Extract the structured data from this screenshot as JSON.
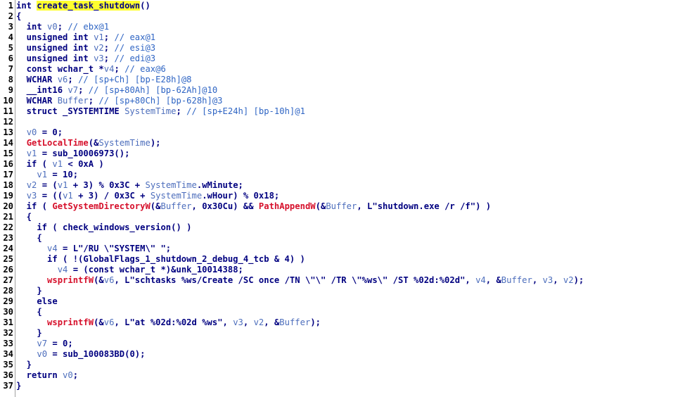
{
  "pseudocode": {
    "function_name": "create_task_shutdown",
    "lines": [
      {
        "n": "1",
        "t": [
          [
            "n",
            "int "
          ],
          [
            "h",
            "create_task_shutdown"
          ],
          [
            "n",
            "()"
          ]
        ]
      },
      {
        "n": "2",
        "t": [
          [
            "n",
            "{"
          ]
        ]
      },
      {
        "n": "3",
        "t": [
          [
            "n",
            "  int "
          ],
          [
            "v",
            "v0"
          ],
          [
            "n",
            "; "
          ],
          [
            "c",
            "// ebx@1"
          ]
        ]
      },
      {
        "n": "4",
        "t": [
          [
            "n",
            "  unsigned int "
          ],
          [
            "v",
            "v1"
          ],
          [
            "n",
            "; "
          ],
          [
            "c",
            "// eax@1"
          ]
        ]
      },
      {
        "n": "5",
        "t": [
          [
            "n",
            "  unsigned int "
          ],
          [
            "v",
            "v2"
          ],
          [
            "n",
            "; "
          ],
          [
            "c",
            "// esi@3"
          ]
        ]
      },
      {
        "n": "6",
        "t": [
          [
            "n",
            "  unsigned int "
          ],
          [
            "v",
            "v3"
          ],
          [
            "n",
            "; "
          ],
          [
            "c",
            "// edi@3"
          ]
        ]
      },
      {
        "n": "7",
        "t": [
          [
            "n",
            "  const wchar_t *"
          ],
          [
            "v",
            "v4"
          ],
          [
            "n",
            "; "
          ],
          [
            "c",
            "// eax@6"
          ]
        ]
      },
      {
        "n": "8",
        "t": [
          [
            "n",
            "  WCHAR "
          ],
          [
            "v",
            "v6"
          ],
          [
            "n",
            "; "
          ],
          [
            "c",
            "// [sp+Ch] [bp-E28h]@8"
          ]
        ]
      },
      {
        "n": "9",
        "t": [
          [
            "n",
            "  __int16 "
          ],
          [
            "v",
            "v7"
          ],
          [
            "n",
            "; "
          ],
          [
            "c",
            "// [sp+80Ah] [bp-62Ah]@10"
          ]
        ]
      },
      {
        "n": "10",
        "t": [
          [
            "n",
            "  WCHAR "
          ],
          [
            "v",
            "Buffer"
          ],
          [
            "n",
            "; "
          ],
          [
            "c",
            "// [sp+80Ch] [bp-628h]@3"
          ]
        ]
      },
      {
        "n": "11",
        "t": [
          [
            "n",
            "  struct _SYSTEMTIME "
          ],
          [
            "v",
            "SystemTime"
          ],
          [
            "n",
            "; "
          ],
          [
            "c",
            "// [sp+E24h] [bp-10h]@1"
          ]
        ]
      },
      {
        "n": "12",
        "t": [
          [
            "n",
            ""
          ]
        ]
      },
      {
        "n": "13",
        "t": [
          [
            "n",
            "  "
          ],
          [
            "v",
            "v0"
          ],
          [
            "n",
            " = 0;"
          ]
        ]
      },
      {
        "n": "14",
        "t": [
          [
            "n",
            "  "
          ],
          [
            "f",
            "GetLocalTime"
          ],
          [
            "n",
            "(&"
          ],
          [
            "v",
            "SystemTime"
          ],
          [
            "n",
            ");"
          ]
        ]
      },
      {
        "n": "15",
        "t": [
          [
            "n",
            "  "
          ],
          [
            "v",
            "v1"
          ],
          [
            "n",
            " = sub_10006973();"
          ]
        ]
      },
      {
        "n": "16",
        "t": [
          [
            "n",
            "  if ( "
          ],
          [
            "v",
            "v1"
          ],
          [
            "n",
            " < 0xA )"
          ]
        ]
      },
      {
        "n": "17",
        "t": [
          [
            "n",
            "    "
          ],
          [
            "v",
            "v1"
          ],
          [
            "n",
            " = 10;"
          ]
        ]
      },
      {
        "n": "18",
        "t": [
          [
            "n",
            "  "
          ],
          [
            "v",
            "v2"
          ],
          [
            "n",
            " = ("
          ],
          [
            "v",
            "v1"
          ],
          [
            "n",
            " + 3) % 0x3C + "
          ],
          [
            "v",
            "SystemTime"
          ],
          [
            "n",
            ".wMinute;"
          ]
        ]
      },
      {
        "n": "19",
        "t": [
          [
            "n",
            "  "
          ],
          [
            "v",
            "v3"
          ],
          [
            "n",
            " = (("
          ],
          [
            "v",
            "v1"
          ],
          [
            "n",
            " + 3) / 0x3C + "
          ],
          [
            "v",
            "SystemTime"
          ],
          [
            "n",
            ".wHour) % 0x18;"
          ]
        ]
      },
      {
        "n": "20",
        "t": [
          [
            "n",
            "  if ( "
          ],
          [
            "f",
            "GetSystemDirectoryW"
          ],
          [
            "n",
            "(&"
          ],
          [
            "v",
            "Buffer"
          ],
          [
            "n",
            ", 0x30Cu) && "
          ],
          [
            "f",
            "PathAppendW"
          ],
          [
            "n",
            "(&"
          ],
          [
            "v",
            "Buffer"
          ],
          [
            "n",
            ", L\"shutdown.exe /r /f\") )"
          ]
        ]
      },
      {
        "n": "21",
        "t": [
          [
            "n",
            "  {"
          ]
        ]
      },
      {
        "n": "22",
        "t": [
          [
            "n",
            "    if ( check_windows_version() )"
          ]
        ]
      },
      {
        "n": "23",
        "t": [
          [
            "n",
            "    {"
          ]
        ]
      },
      {
        "n": "24",
        "t": [
          [
            "n",
            "      "
          ],
          [
            "v",
            "v4"
          ],
          [
            "n",
            " = L\"/RU \\\"SYSTEM\\\" \";"
          ]
        ]
      },
      {
        "n": "25",
        "t": [
          [
            "n",
            "      if ( !(GlobalFlags_1_shutdown_2_debug_4_tcb & 4) )"
          ]
        ]
      },
      {
        "n": "26",
        "t": [
          [
            "n",
            "        "
          ],
          [
            "v",
            "v4"
          ],
          [
            "n",
            " = (const wchar_t *)&unk_10014388;"
          ]
        ]
      },
      {
        "n": "27",
        "t": [
          [
            "n",
            "      "
          ],
          [
            "f",
            "wsprintfW"
          ],
          [
            "n",
            "(&"
          ],
          [
            "v",
            "v6"
          ],
          [
            "n",
            ", L\"schtasks %ws/Create /SC once /TN \\\"\\\" /TR \\\"%ws\\\" /ST %02d:%02d\", "
          ],
          [
            "v",
            "v4"
          ],
          [
            "n",
            ", &"
          ],
          [
            "v",
            "Buffer"
          ],
          [
            "n",
            ", "
          ],
          [
            "v",
            "v3"
          ],
          [
            "n",
            ", "
          ],
          [
            "v",
            "v2"
          ],
          [
            "n",
            ");"
          ]
        ]
      },
      {
        "n": "28",
        "t": [
          [
            "n",
            "    }"
          ]
        ]
      },
      {
        "n": "29",
        "t": [
          [
            "n",
            "    else"
          ]
        ]
      },
      {
        "n": "30",
        "t": [
          [
            "n",
            "    {"
          ]
        ]
      },
      {
        "n": "31",
        "t": [
          [
            "n",
            "      "
          ],
          [
            "f",
            "wsprintfW"
          ],
          [
            "n",
            "(&"
          ],
          [
            "v",
            "v6"
          ],
          [
            "n",
            ", L\"at %02d:%02d %ws\", "
          ],
          [
            "v",
            "v3"
          ],
          [
            "n",
            ", "
          ],
          [
            "v",
            "v2"
          ],
          [
            "n",
            ", &"
          ],
          [
            "v",
            "Buffer"
          ],
          [
            "n",
            ");"
          ]
        ]
      },
      {
        "n": "32",
        "t": [
          [
            "n",
            "    }"
          ]
        ]
      },
      {
        "n": "33",
        "t": [
          [
            "n",
            "    "
          ],
          [
            "v",
            "v7"
          ],
          [
            "n",
            " = 0;"
          ]
        ]
      },
      {
        "n": "34",
        "t": [
          [
            "n",
            "    "
          ],
          [
            "v",
            "v0"
          ],
          [
            "n",
            " = sub_100083BD(0);"
          ]
        ]
      },
      {
        "n": "35",
        "t": [
          [
            "n",
            "  }"
          ]
        ]
      },
      {
        "n": "36",
        "t": [
          [
            "n",
            "  return "
          ],
          [
            "v",
            "v0"
          ],
          [
            "n",
            ";"
          ]
        ]
      },
      {
        "n": "37",
        "t": [
          [
            "n",
            "}"
          ]
        ]
      }
    ]
  },
  "colors": {
    "background": "#ffffff",
    "text": "#000080",
    "variable": "#4d6ebc",
    "comment": "#2f65c4",
    "api_call": "#d6102b",
    "highlight": "#ffff2e"
  }
}
